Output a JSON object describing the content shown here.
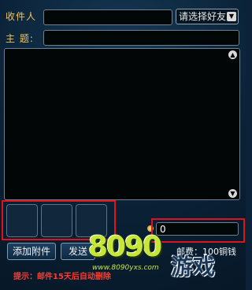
{
  "compose": {
    "recipient_label": "收件人",
    "subject_label": "主  题:",
    "friend_select": "请选择好友",
    "recipient_value": "",
    "subject_value": "",
    "body_value": ""
  },
  "money": {
    "value": "0",
    "postage_label": "邮费：100铜钱"
  },
  "actions": {
    "attach_label": "添加附件",
    "send_label": "发送"
  },
  "hint": "提示：邮件15天后自动删除",
  "watermark": {
    "logo_text": "8090",
    "site_text": "www.8090yxs.com",
    "brand_text": "游戏"
  },
  "colors": {
    "label": "#f3c454",
    "highlight": "#e0121c",
    "hint": "#ff3a2c"
  }
}
